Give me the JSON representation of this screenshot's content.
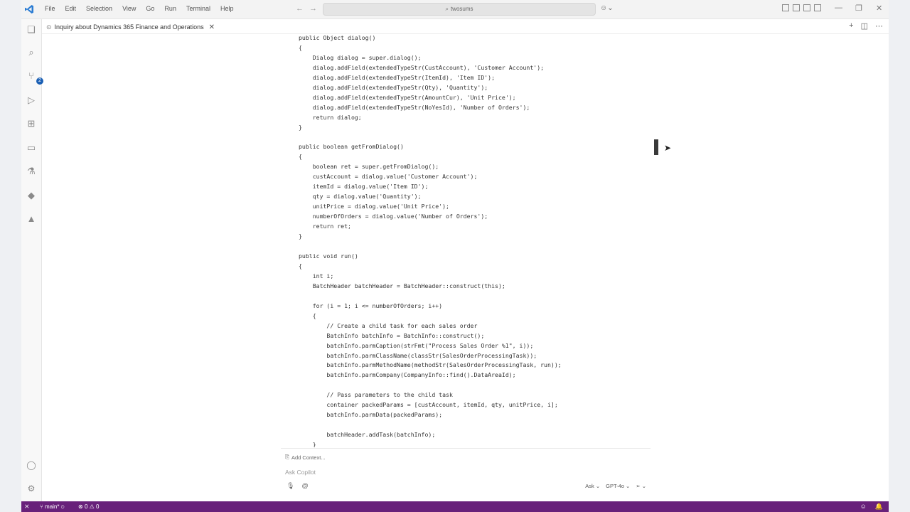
{
  "menu": [
    "File",
    "Edit",
    "Selection",
    "View",
    "Go",
    "Run",
    "Terminal",
    "Help"
  ],
  "search": {
    "text": "twosums"
  },
  "activity_badge": "2",
  "tab": {
    "label": "Inquiry about Dynamics 365 Finance and Operations"
  },
  "code_lines": [
    "public Object dialog()",
    "{",
    "    Dialog dialog = super.dialog();",
    "    dialog.addField(extendedTypeStr(CustAccount), 'Customer Account');",
    "    dialog.addField(extendedTypeStr(ItemId), 'Item ID');",
    "    dialog.addField(extendedTypeStr(Qty), 'Quantity');",
    "    dialog.addField(extendedTypeStr(AmountCur), 'Unit Price');",
    "    dialog.addField(extendedTypeStr(NoYesId), 'Number of Orders');",
    "    return dialog;",
    "}",
    "",
    "public boolean getFromDialog()",
    "{",
    "    boolean ret = super.getFromDialog();",
    "    custAccount = dialog.value('Customer Account');",
    "    itemId = dialog.value('Item ID');",
    "    qty = dialog.value('Quantity');",
    "    unitPrice = dialog.value('Unit Price');",
    "    numberOfOrders = dialog.value('Number of Orders');",
    "    return ret;",
    "}",
    "",
    "public void run()",
    "{",
    "    int i;",
    "    BatchHeader batchHeader = BatchHeader::construct(this);",
    "",
    "    for (i = 1; i <= numberOfOrders; i++)",
    "    {",
    "        // Create a child task for each sales order",
    "        BatchInfo batchInfo = BatchInfo::construct();",
    "        batchInfo.parmCaption(strFmt(\"Process Sales Order %1\", i));",
    "        batchInfo.parmClassName(classStr(SalesOrderProcessingTask));",
    "        batchInfo.parmMethodName(methodStr(SalesOrderProcessingTask, run));",
    "        batchInfo.parmCompany(CompanyInfo::find().DataAreaId);",
    "",
    "        // Pass parameters to the child task",
    "        container packedParams = [custAccount, itemId, qty, unitPrice, i];",
    "        batchInfo.parmData(packedParams);",
    "",
    "        batchHeader.addTask(batchInfo);",
    "    }"
  ],
  "chat": {
    "add_context": "Add Context...",
    "placeholder": "Ask Copilot",
    "mode": "Ask",
    "model": "GPT-4o"
  },
  "status": {
    "branch": "main*",
    "errors": "0",
    "warnings": "0"
  },
  "colors": {
    "statusbar": "#68217a",
    "accent": "#1a5fb4"
  }
}
